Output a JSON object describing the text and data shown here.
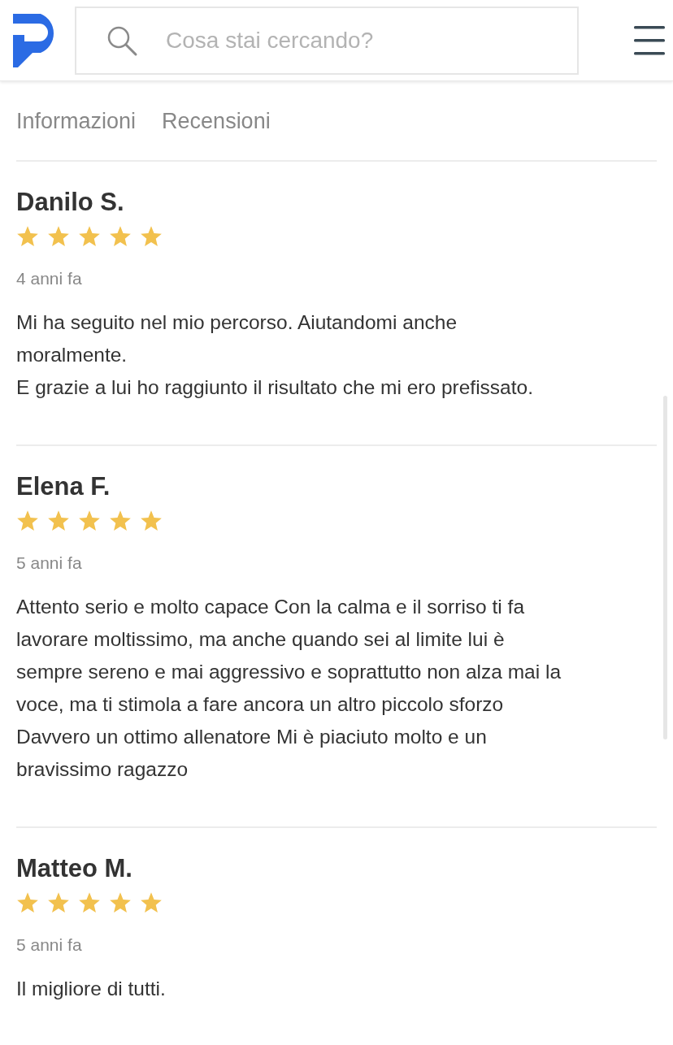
{
  "header": {
    "search": {
      "placeholder": "Cosa stai cercando?"
    }
  },
  "tabs": [
    {
      "label": "Informazioni",
      "selected": false
    },
    {
      "label": "Recensioni",
      "selected": false
    }
  ],
  "reviews": [
    {
      "name": "Danilo S.",
      "stars": 5,
      "date": "4 anni fa",
      "lines": [
        "Mi ha seguito nel mio percorso. Aiutandomi anche",
        "moralmente.",
        "E grazie a lui ho raggiunto il risultato che mi ero prefissato."
      ]
    },
    {
      "name": "Elena F.",
      "stars": 5,
      "date": "5 anni fa",
      "lines": [
        "Attento serio e molto capace Con la calma e il sorriso ti fa",
        "lavorare moltissimo, ma anche quando sei al limite lui è",
        "sempre sereno e mai aggressivo e soprattutto non alza mai la",
        "voce, ma ti stimola a fare ancora un altro piccolo sforzo",
        "Davvero un ottimo allenatore Mi è piaciuto molto e un",
        "bravissimo ragazzo"
      ]
    },
    {
      "name": "Matteo M.",
      "stars": 5,
      "date": "5 anni fa",
      "lines": [
        "Il migliore di tutti."
      ]
    }
  ]
}
